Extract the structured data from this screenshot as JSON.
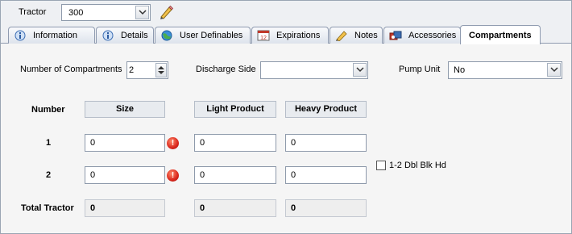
{
  "tractor": {
    "label": "Tractor",
    "value": "300"
  },
  "tabs": [
    {
      "label": "Information",
      "icon": "info-icon",
      "active": false
    },
    {
      "label": "Details",
      "icon": "details-icon",
      "active": false
    },
    {
      "label": "User Definables",
      "icon": "globe-icon",
      "active": false
    },
    {
      "label": "Expirations",
      "icon": "calendar-icon",
      "active": false
    },
    {
      "label": "Notes",
      "icon": "pencil-icon",
      "active": false
    },
    {
      "label": "Accessories",
      "icon": "accessories-icon",
      "active": false
    },
    {
      "label": "Compartments",
      "icon": "",
      "active": true
    }
  ],
  "calendar_day": "12",
  "compartments": {
    "num_label": "Number of Compartments",
    "num_value": "2",
    "discharge_label": "Discharge Side",
    "discharge_value": "",
    "pump_label": "Pump Unit",
    "pump_value": "No",
    "columns": {
      "number": "Number",
      "size": "Size",
      "light": "Light Product",
      "heavy": "Heavy Product"
    },
    "rows": [
      {
        "number": "1",
        "size": "0",
        "light": "0",
        "heavy": "0"
      },
      {
        "number": "2",
        "size": "0",
        "light": "0",
        "heavy": "0"
      }
    ],
    "error_glyph": "!",
    "dbl_blk_label": "1-2 Dbl Blk Hd",
    "total": {
      "label": "Total Tractor",
      "size": "0",
      "light": "0",
      "heavy": "0"
    }
  },
  "colors": {
    "border": "#8e9aab",
    "error": "#d9261c",
    "tab_active_bg": "#ffffff"
  }
}
